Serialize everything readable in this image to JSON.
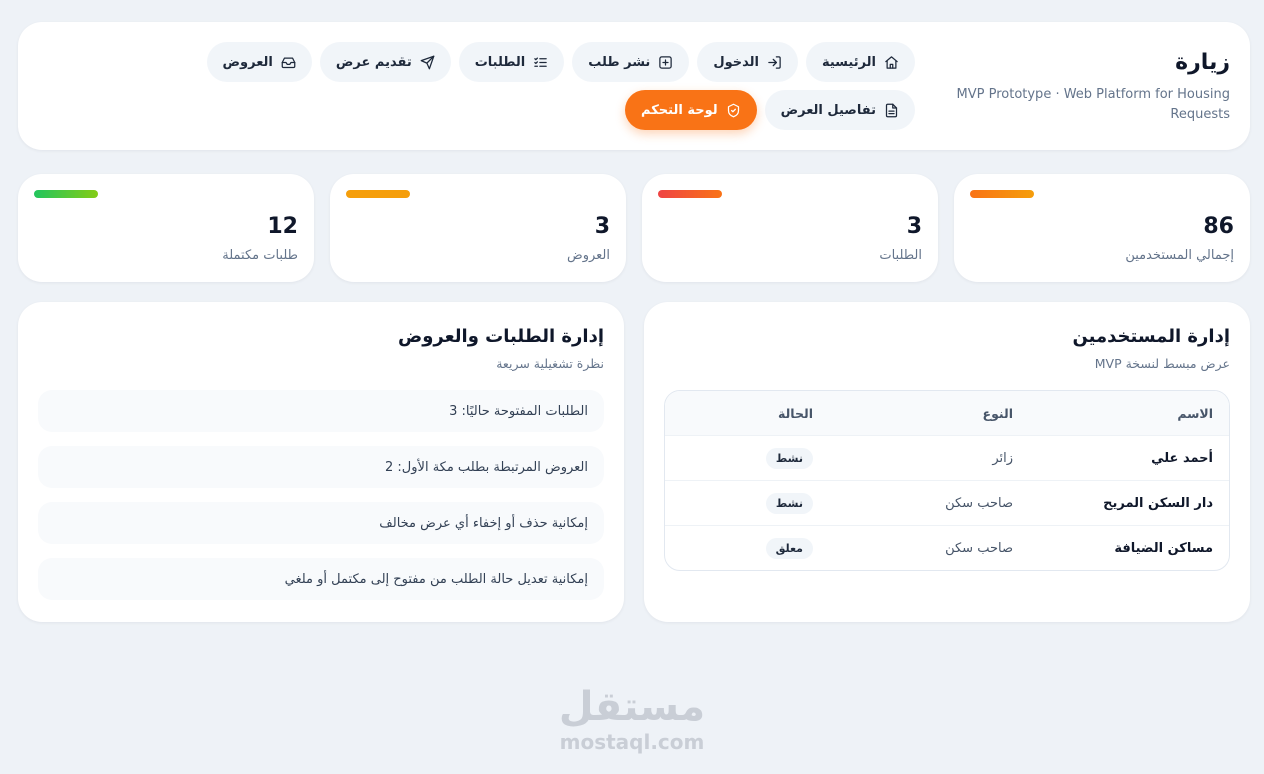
{
  "header": {
    "title": "زيارة",
    "subtitle": "MVP Prototype · Web Platform for Housing Requests",
    "nav": [
      {
        "label": "الرئيسية",
        "icon": "home-icon"
      },
      {
        "label": "الدخول",
        "icon": "login-icon"
      },
      {
        "label": "نشر طلب",
        "icon": "plus-square-icon"
      },
      {
        "label": "الطلبات",
        "icon": "list-check-icon"
      },
      {
        "label": "تقديم عرض",
        "icon": "send-icon"
      },
      {
        "label": "العروض",
        "icon": "inbox-icon"
      },
      {
        "label": "تفاصيل العرض",
        "icon": "document-icon"
      },
      {
        "label": "لوحة التحكم",
        "icon": "shield-check-icon"
      }
    ],
    "accent_color": "#f97316"
  },
  "stats": [
    {
      "value": "86",
      "label": "إجمالي المستخدمين",
      "bar_colors": [
        "#f97316",
        "#f59e0b"
      ]
    },
    {
      "value": "3",
      "label": "الطلبات",
      "bar_colors": [
        "#ef4444",
        "#f97316"
      ]
    },
    {
      "value": "3",
      "label": "العروض",
      "bar_colors": [
        "#f59e0b",
        "#f59e0b"
      ]
    },
    {
      "value": "12",
      "label": "طلبات مكتملة",
      "bar_colors": [
        "#22c55e",
        "#84cc16"
      ]
    }
  ],
  "users_panel": {
    "title": "إدارة المستخدمين",
    "subtitle": "عرض مبسط لنسخة MVP",
    "columns": {
      "name": "الاسم",
      "type": "النوع",
      "status": "الحالة"
    },
    "rows": [
      {
        "name": "أحمد علي",
        "type": "زائر",
        "status": "نشط"
      },
      {
        "name": "دار السكن المريح",
        "type": "صاحب سكن",
        "status": "نشط"
      },
      {
        "name": "مساكن الضيافة",
        "type": "صاحب سكن",
        "status": "معلق"
      }
    ]
  },
  "requests_panel": {
    "title": "إدارة الطلبات والعروض",
    "subtitle": "نظرة تشغيلية سريعة",
    "items": [
      "الطلبات المفتوحة حاليًا: 3",
      "العروض المرتبطة بطلب مكة الأول: 2",
      "إمكانية حذف أو إخفاء أي عرض مخالف",
      "إمكانية تعديل حالة الطلب من مفتوح إلى مكتمل أو ملغي"
    ]
  },
  "watermark": {
    "arabic": "مستقل",
    "latin": "mostaql.com"
  }
}
